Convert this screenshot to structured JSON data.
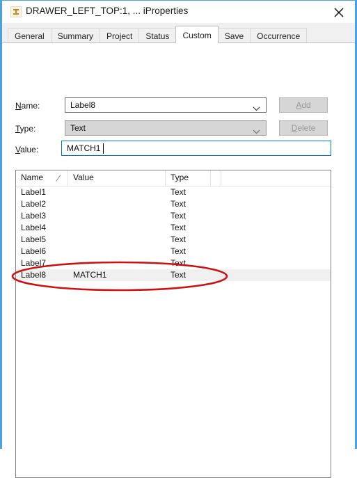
{
  "window": {
    "title": "DRAWER_LEFT_TOP:1, ... iProperties",
    "app_icon": "inventor-iproperties-icon",
    "close_label": "✕",
    "border_color": "#4aa3e0"
  },
  "tabs": [
    {
      "label": "General",
      "active": false
    },
    {
      "label": "Summary",
      "active": false
    },
    {
      "label": "Project",
      "active": false
    },
    {
      "label": "Status",
      "active": false
    },
    {
      "label": "Custom",
      "active": true
    },
    {
      "label": "Save",
      "active": false
    },
    {
      "label": "Occurrence",
      "active": false
    }
  ],
  "form": {
    "name": {
      "label_prefix": "",
      "label_accel": "N",
      "label_suffix": "ame:",
      "value": "Label8",
      "enabled": true,
      "arrow_icon": "chevron-down-icon"
    },
    "type": {
      "label_accel": "T",
      "label_suffix": "ype:",
      "value": "Text",
      "enabled": false,
      "arrow_icon": "chevron-down-icon"
    },
    "value": {
      "label_accel": "V",
      "label_suffix": "alue:",
      "value": "MATCH1",
      "placeholder": "",
      "focused": true
    }
  },
  "buttons": {
    "add": {
      "accel": "A",
      "suffix": "dd",
      "enabled": false
    },
    "delete": {
      "accel": "D",
      "suffix": "elete",
      "enabled": false
    }
  },
  "list": {
    "columns": [
      {
        "label": "Name",
        "sorted": true,
        "sort_icon": "sort-ascending-icon"
      },
      {
        "label": "Value",
        "sorted": false
      },
      {
        "label": "Type",
        "sorted": false
      },
      {
        "label": "",
        "sorted": false
      },
      {
        "label": "",
        "sorted": false
      }
    ],
    "rows": [
      {
        "name": "Label1",
        "value": "",
        "type": "Text",
        "selected": false
      },
      {
        "name": "Label2",
        "value": "",
        "type": "Text",
        "selected": false
      },
      {
        "name": "Label3",
        "value": "",
        "type": "Text",
        "selected": false
      },
      {
        "name": "Label4",
        "value": "",
        "type": "Text",
        "selected": false
      },
      {
        "name": "Label5",
        "value": "",
        "type": "Text",
        "selected": false
      },
      {
        "name": "Label6",
        "value": "",
        "type": "Text",
        "selected": false
      },
      {
        "name": "Label7",
        "value": "",
        "type": "Text",
        "selected": false
      },
      {
        "name": "Label8",
        "value": "MATCH1",
        "type": "Text",
        "selected": true
      }
    ]
  },
  "annotation": {
    "shape": "ellipse",
    "color": "#cc1111",
    "targets_row": "Label8"
  }
}
